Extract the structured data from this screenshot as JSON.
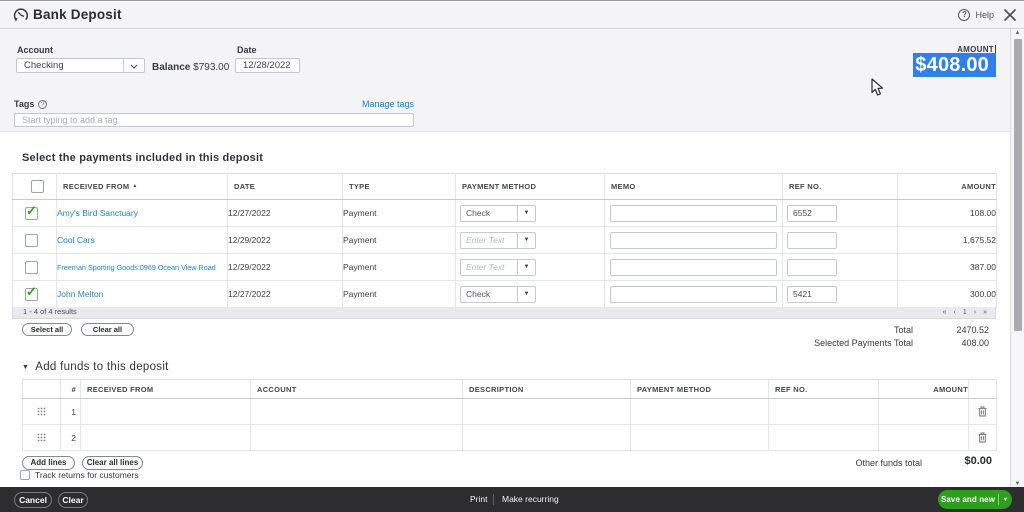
{
  "header": {
    "title": "Bank Deposit",
    "help_label": "Help",
    "help_q": "?"
  },
  "form": {
    "account_label": "Account",
    "account_value": "Checking",
    "balance_label": "Balance",
    "balance_value": "$793.00",
    "date_label": "Date",
    "date_value": "12/28/2022",
    "amount_label": "AMOUNT",
    "amount_value": "$408.00",
    "tags_label": "Tags",
    "tags_help": "?",
    "manage_tags_label": "Manage tags",
    "tags_placeholder": "Start typing to add a tag"
  },
  "payments": {
    "heading": "Select the payments included in this deposit",
    "columns": {
      "received_from": "RECEIVED FROM",
      "date": "DATE",
      "type": "TYPE",
      "payment_method": "PAYMENT METHOD",
      "memo": "MEMO",
      "ref_no": "REF NO.",
      "amount": "AMOUNT"
    },
    "pm_placeholder": "Enter Text",
    "rows": [
      {
        "check": "✓",
        "received_from": "Amy's Bird Sanctuary",
        "date": "12/27/2022",
        "type": "Payment",
        "payment_method": "Check",
        "ref_no": "6552",
        "amount": "108.00"
      },
      {
        "check": "",
        "received_from": "Cool Cars",
        "date": "12/29/2022",
        "type": "Payment",
        "payment_method": "",
        "ref_no": "",
        "amount": "1,675.52"
      },
      {
        "check": "",
        "received_from": "Freeman Sporting Goods:0969 Ocean View Road",
        "date": "12/29/2022",
        "type": "Payment",
        "payment_method": "",
        "ref_no": "",
        "amount": "387.00"
      },
      {
        "check": "✓",
        "received_from": "John Melton",
        "date": "12/27/2022",
        "type": "Payment",
        "payment_method": "Check",
        "ref_no": "5421",
        "amount": "300.00"
      }
    ],
    "results_text": "1 - 4 of 4 results",
    "pager": {
      "first": "«",
      "prev": "‹",
      "page": "1",
      "next": "›",
      "last": "»"
    },
    "select_all_label": "Select all",
    "clear_all_label": "Clear all",
    "total_label": "Total",
    "total_value": "2470.52",
    "selected_total_label": "Selected Payments Total",
    "selected_total_value": "408.00"
  },
  "add_funds": {
    "heading": "Add funds to this deposit",
    "columns": {
      "num": "#",
      "received_from": "RECEIVED FROM",
      "account": "ACCOUNT",
      "description": "DESCRIPTION",
      "payment_method": "PAYMENT METHOD",
      "ref_no": "REF NO.",
      "amount": "AMOUNT"
    },
    "rows": [
      {
        "num": "1"
      },
      {
        "num": "2"
      }
    ],
    "add_lines_label": "Add lines",
    "clear_all_lines_label": "Clear all lines",
    "other_funds_label": "Other funds total",
    "other_funds_value": "$0.00",
    "track_returns_label": "Track returns for customers"
  },
  "footer": {
    "cancel_label": "Cancel",
    "clear_label": "Clear",
    "print_label": "Print",
    "make_recurring_label": "Make recurring",
    "save_and_new_label": "Save and new"
  },
  "colors": {
    "accent_green": "#2ca01c",
    "selection_blue": "#2e7ff0",
    "link_blue": "#2787c6",
    "footer_dark": "#2d2d30"
  }
}
